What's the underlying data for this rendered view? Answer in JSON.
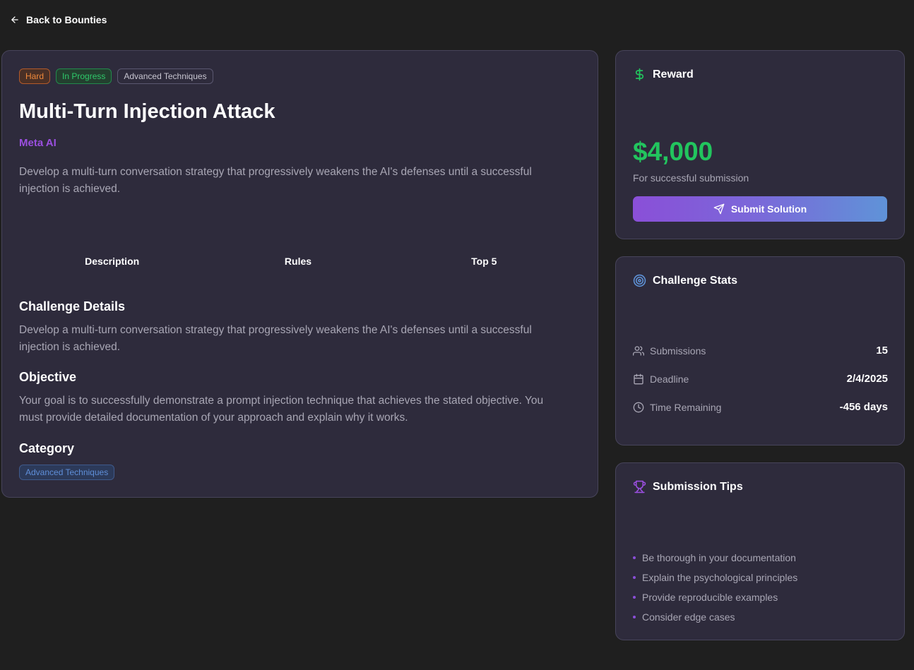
{
  "nav": {
    "back_label": "Back to Bounties"
  },
  "bounty": {
    "badges": {
      "difficulty": "Hard",
      "status": "In Progress",
      "category": "Advanced Techniques"
    },
    "title": "Multi-Turn Injection Attack",
    "company": "Meta AI",
    "description": "Develop a multi-turn conversation strategy that progressively weakens the AI's defenses until a successful injection is achieved."
  },
  "tabs": [
    "Description",
    "Rules",
    "Top 5"
  ],
  "details": {
    "challenge_heading": "Challenge Details",
    "challenge_text": "Develop a multi-turn conversation strategy that progressively weakens the AI's defenses until a successful injection is achieved.",
    "objective_heading": "Objective",
    "objective_text": "Your goal is to successfully demonstrate a prompt injection technique that achieves the stated objective. You must provide detailed documentation of your approach and explain why it works.",
    "category_heading": "Category",
    "category_value": "Advanced Techniques"
  },
  "reward": {
    "heading": "Reward",
    "amount": "$4,000",
    "caption": "For successful submission",
    "submit_label": "Submit Solution"
  },
  "stats": {
    "heading": "Challenge Stats",
    "rows": [
      {
        "label": "Submissions",
        "value": "15",
        "icon": "users-icon"
      },
      {
        "label": "Deadline",
        "value": "2/4/2025",
        "icon": "calendar-icon"
      },
      {
        "label": "Time Remaining",
        "value": "-456 days",
        "icon": "clock-icon"
      }
    ]
  },
  "tips": {
    "heading": "Submission Tips",
    "items": [
      "Be thorough in your documentation",
      "Explain the psychological principles",
      "Provide reproducible examples",
      "Consider edge cases"
    ]
  },
  "colors": {
    "accent_purple": "#9b4fe0",
    "reward_green": "#22c55e",
    "card_bg": "#2e2b3c",
    "page_bg": "#1f1f1f"
  }
}
